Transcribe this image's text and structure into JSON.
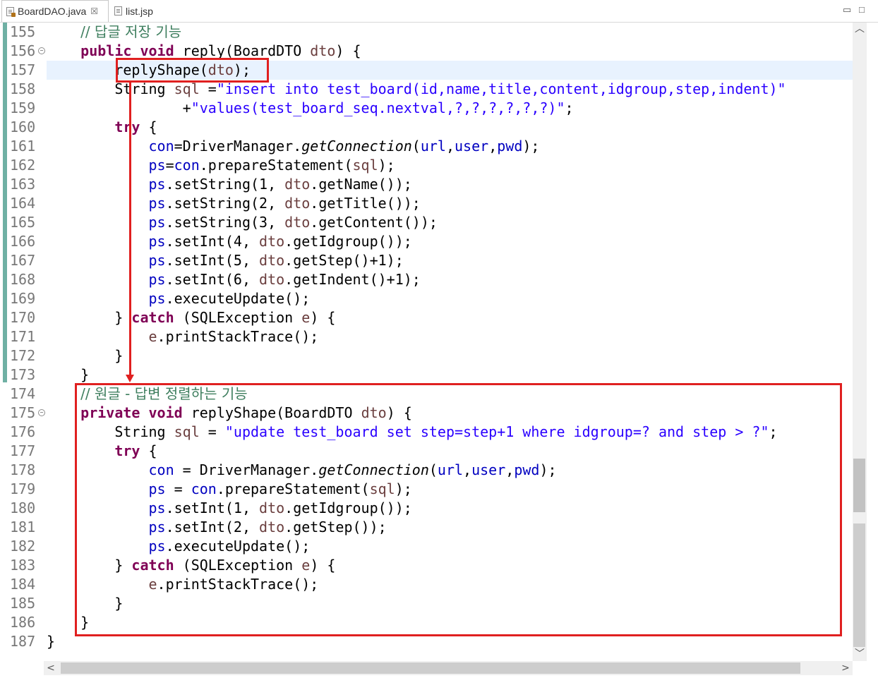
{
  "tabs": [
    {
      "label": "BoardDAO.java",
      "close": "☒",
      "active": true
    },
    {
      "label": "list.jsp",
      "active": false
    }
  ],
  "window_controls": {
    "minimize": "▭",
    "maximize": "□"
  },
  "scroll": {
    "up": "︿",
    "down": "﹀",
    "left": "<",
    "right": ">"
  },
  "line_numbers": [
    "155",
    "156",
    "157",
    "158",
    "159",
    "160",
    "161",
    "162",
    "163",
    "164",
    "165",
    "166",
    "167",
    "168",
    "169",
    "170",
    "171",
    "172",
    "173",
    "174",
    "175",
    "176",
    "177",
    "178",
    "179",
    "180",
    "181",
    "182",
    "183",
    "184",
    "185",
    "186",
    "187"
  ],
  "fold_markers": [
    "156",
    "175"
  ],
  "current_line": "157",
  "code_lines": [
    "    // 답글 저장 기능",
    "    public void reply(BoardDTO dto) {",
    "        replyShape(dto);",
    "        String sql =\"insert into test_board(id,name,title,content,idgroup,step,indent)\"",
    "                +\"values(test_board_seq.nextval,?,?,?,?,?,?)\";",
    "        try {",
    "            con=DriverManager.getConnection(url,user,pwd);",
    "            ps=con.prepareStatement(sql);",
    "            ps.setString(1, dto.getName());",
    "            ps.setString(2, dto.getTitle());",
    "            ps.setString(3, dto.getContent());",
    "            ps.setInt(4, dto.getIdgroup());",
    "            ps.setInt(5, dto.getStep()+1);",
    "            ps.setInt(6, dto.getIndent()+1);",
    "            ps.executeUpdate();",
    "        } catch (SQLException e) {",
    "            e.printStackTrace();",
    "        }",
    "    }",
    "    // 원글 - 답변 정렬하는 기능",
    "    private void replyShape(BoardDTO dto) {",
    "        String sql = \"update test_board set step=step+1 where idgroup=? and step > ?\";",
    "        try {",
    "            con = DriverManager.getConnection(url,user,pwd);",
    "            ps = con.prepareStatement(sql);",
    "            ps.setInt(1, dto.getIdgroup());",
    "            ps.setInt(2, dto.getStep());",
    "            ps.executeUpdate();",
    "        } catch (SQLException e) {",
    "            e.printStackTrace();",
    "        }",
    "    }",
    "}"
  ],
  "annotations": {
    "colors": {
      "highlight": "#e02020"
    }
  },
  "syntax_colors": {
    "keyword": "#7f0055",
    "comment": "#3f7f5f",
    "string": "#2a00ff",
    "field": "#0000c0",
    "local_var": "#6a3e3e",
    "line_number": "#787878",
    "current_line_bg": "#e8f2fe"
  }
}
